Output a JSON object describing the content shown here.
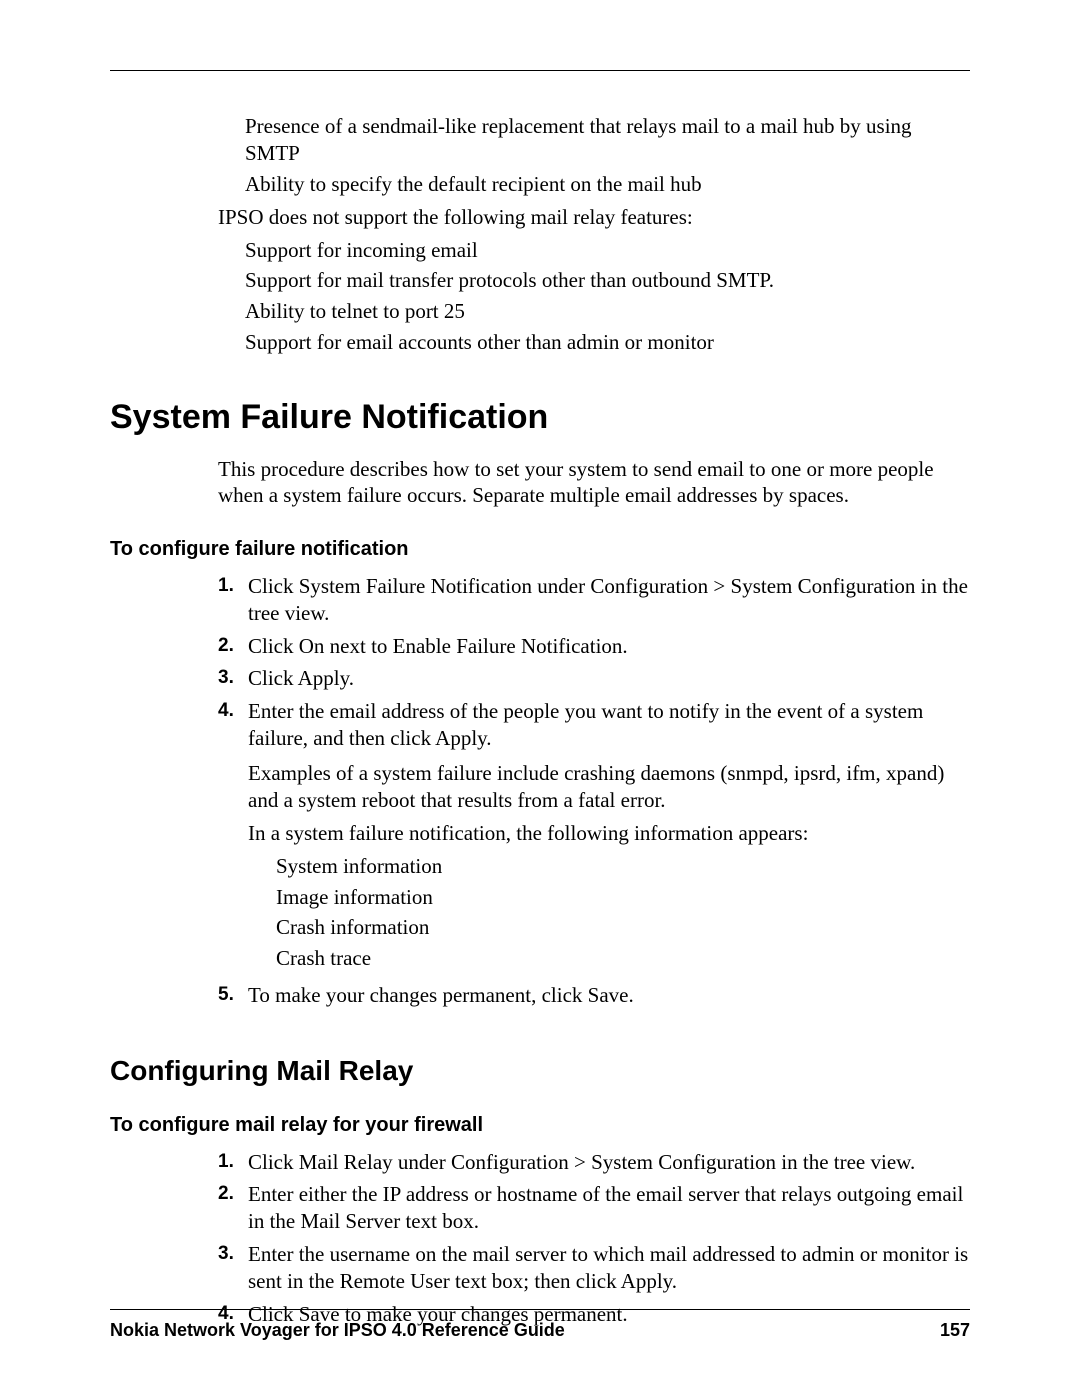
{
  "intro": {
    "supported": [
      "Presence of a sendmail-like replacement that relays mail to a mail hub by using SMTP",
      "Ability to specify the default recipient on the mail hub"
    ],
    "unsupported_lead": "IPSO does not support the following mail relay features:",
    "unsupported": [
      "Support for incoming email",
      "Support for mail transfer protocols other than outbound SMTP.",
      "Ability to telnet to port 25",
      "Support for email accounts other than admin or monitor"
    ]
  },
  "section1": {
    "heading": "System Failure Notification",
    "desc": "This procedure describes how to set your system to send email to one or more people when a system failure occurs. Separate multiple email addresses by spaces.",
    "subheading": "To configure failure notification",
    "steps": [
      "Click System Failure Notification under Configuration > System Configuration in the tree view.",
      "Click On next to Enable Failure Notification.",
      "Click Apply.",
      "Enter the email address of the people you want to notify in the event of a system failure, and then click Apply.",
      "To make your changes permanent, click Save."
    ],
    "step4_extra": [
      "Examples of a system failure include crashing daemons (snmpd, ipsrd, ifm, xpand) and a system reboot that results from a fatal error.",
      "In a system failure notification, the following information appears:"
    ],
    "step4_bullets": [
      "System information",
      "Image information",
      "Crash information",
      "Crash trace"
    ]
  },
  "section2": {
    "heading": "Configuring Mail Relay",
    "subheading": "To configure mail relay for your firewall",
    "steps": [
      "Click Mail Relay under Configuration > System Configuration in the tree view.",
      "Enter either the IP address or hostname of the email server that relays outgoing email in the Mail Server text box.",
      "Enter the username on the mail server to which mail addressed to admin or monitor is sent in the Remote User text box; then click Apply.",
      "Click Save to make your changes permanent."
    ]
  },
  "footer": {
    "title": "Nokia Network Voyager for IPSO 4.0 Reference Guide",
    "page": "157"
  },
  "nums": {
    "n1": "1.",
    "n2": "2.",
    "n3": "3.",
    "n4": "4.",
    "n5": "5."
  }
}
